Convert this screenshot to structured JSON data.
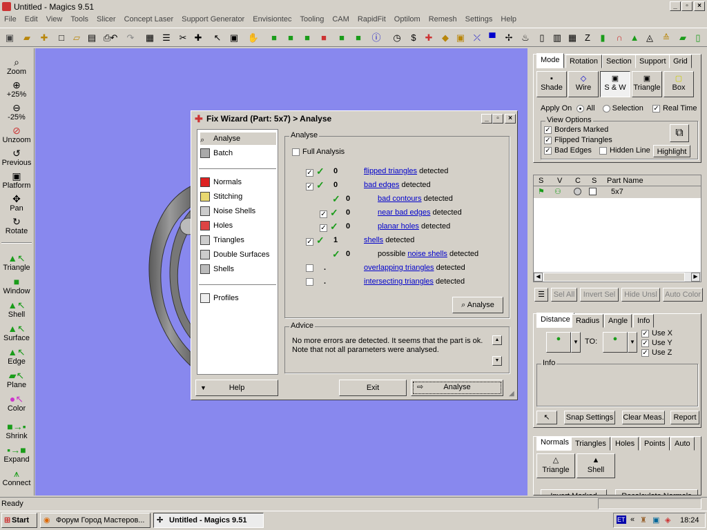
{
  "window": {
    "title": "Untitled - Magics 9.51"
  },
  "menu": [
    "File",
    "Edit",
    "View",
    "Tools",
    "Slicer",
    "Concept Laser",
    "Support Generator",
    "Envisiontec",
    "Tooling",
    "CAM",
    "RapidFit",
    "Optilom",
    "Remesh",
    "Settings",
    "Help"
  ],
  "left_tools": [
    "Zoom",
    "+25%",
    "-25%",
    "Unzoom",
    "Previous",
    "Platform",
    "Pan",
    "Rotate",
    "Triangle",
    "Window",
    "Shell",
    "Surface",
    "Edge",
    "Plane",
    "Color",
    "Shrink",
    "Expand",
    "Connect"
  ],
  "right": {
    "top_tabs": [
      "Mode",
      "Rotation",
      "Section",
      "Support",
      "Grid"
    ],
    "mode_buttons": [
      "Shade",
      "Wire",
      "S & W",
      "Triangle",
      "Box"
    ],
    "apply_on_label": "Apply On",
    "apply_all": "All",
    "apply_selection": "Selection",
    "real_time": "Real Time",
    "view_options_label": "View Options",
    "borders_marked": "Borders Marked",
    "flipped_triangles": "Flipped Triangles",
    "bad_edges": "Bad Edges",
    "hidden_line": "Hidden Line",
    "highlight": "Highlight",
    "parts_headers": [
      "S",
      "V",
      "C",
      "S",
      "Part Name"
    ],
    "part_name": "5x7",
    "part_buttons": [
      "Sel All",
      "Invert Sel",
      "Hide Unsl",
      "Auto Color"
    ],
    "meas_tabs": [
      "Distance",
      "Radius",
      "Angle",
      "Info"
    ],
    "to_label": "TO:",
    "use_x": "Use X",
    "use_y": "Use Y",
    "use_z": "Use Z",
    "info_label": "Info",
    "meas_buttons": [
      "Snap Settings",
      "Clear Meas.",
      "Report"
    ],
    "bottom_tabs": [
      "Normals",
      "Triangles",
      "Holes",
      "Points",
      "Auto"
    ],
    "bottom_buttons": [
      "Triangle",
      "Shell"
    ],
    "cut_buttons": [
      "Invert Marked",
      "Recalculate Normals"
    ]
  },
  "dialog": {
    "title": "Fix Wizard (Part: 5x7) > Analyse",
    "nav_top": [
      "Analyse",
      "Batch"
    ],
    "nav_mid": [
      "Normals",
      "Stitching",
      "Noise Shells",
      "Holes",
      "Triangles",
      "Double Surfaces",
      "Shells"
    ],
    "nav_bottom": [
      "Profiles"
    ],
    "analyse_label": "Analyse",
    "full_analysis": "Full Analysis",
    "rows": [
      {
        "count": "0",
        "link": "flipped triangles",
        "suffix": "detected"
      },
      {
        "count": "0",
        "link": "bad edges",
        "suffix": "detected"
      },
      {
        "count": "0",
        "link": "bad contours",
        "suffix": "detected"
      },
      {
        "count": "0",
        "link": "near bad edges",
        "suffix": "detected"
      },
      {
        "count": "0",
        "link": "planar holes",
        "suffix": "detected"
      },
      {
        "count": "1",
        "link": "shells",
        "suffix": "detected"
      },
      {
        "count": "0",
        "prefix": "possible",
        "link": "noise shells",
        "suffix": "detected"
      },
      {
        "count": ".",
        "link": "overlapping triangles",
        "suffix": "detected"
      },
      {
        "count": ".",
        "link": "intersecting triangles",
        "suffix": "detected"
      }
    ],
    "analyse_button": "Analyse",
    "advice_label": "Advice",
    "advice_line1": "No more errors are detected. It seems that the part is ok.",
    "advice_line2": "Note that not all parameters were analysed.",
    "help": "Help",
    "exit": "Exit",
    "analyse2": "Analyse"
  },
  "status": "Ready",
  "taskbar": {
    "start": "Start",
    "task1": "Форум Город Мастеров...",
    "task2": "Untitled - Magics 9.51",
    "lang": "ET",
    "time": "18:24"
  }
}
